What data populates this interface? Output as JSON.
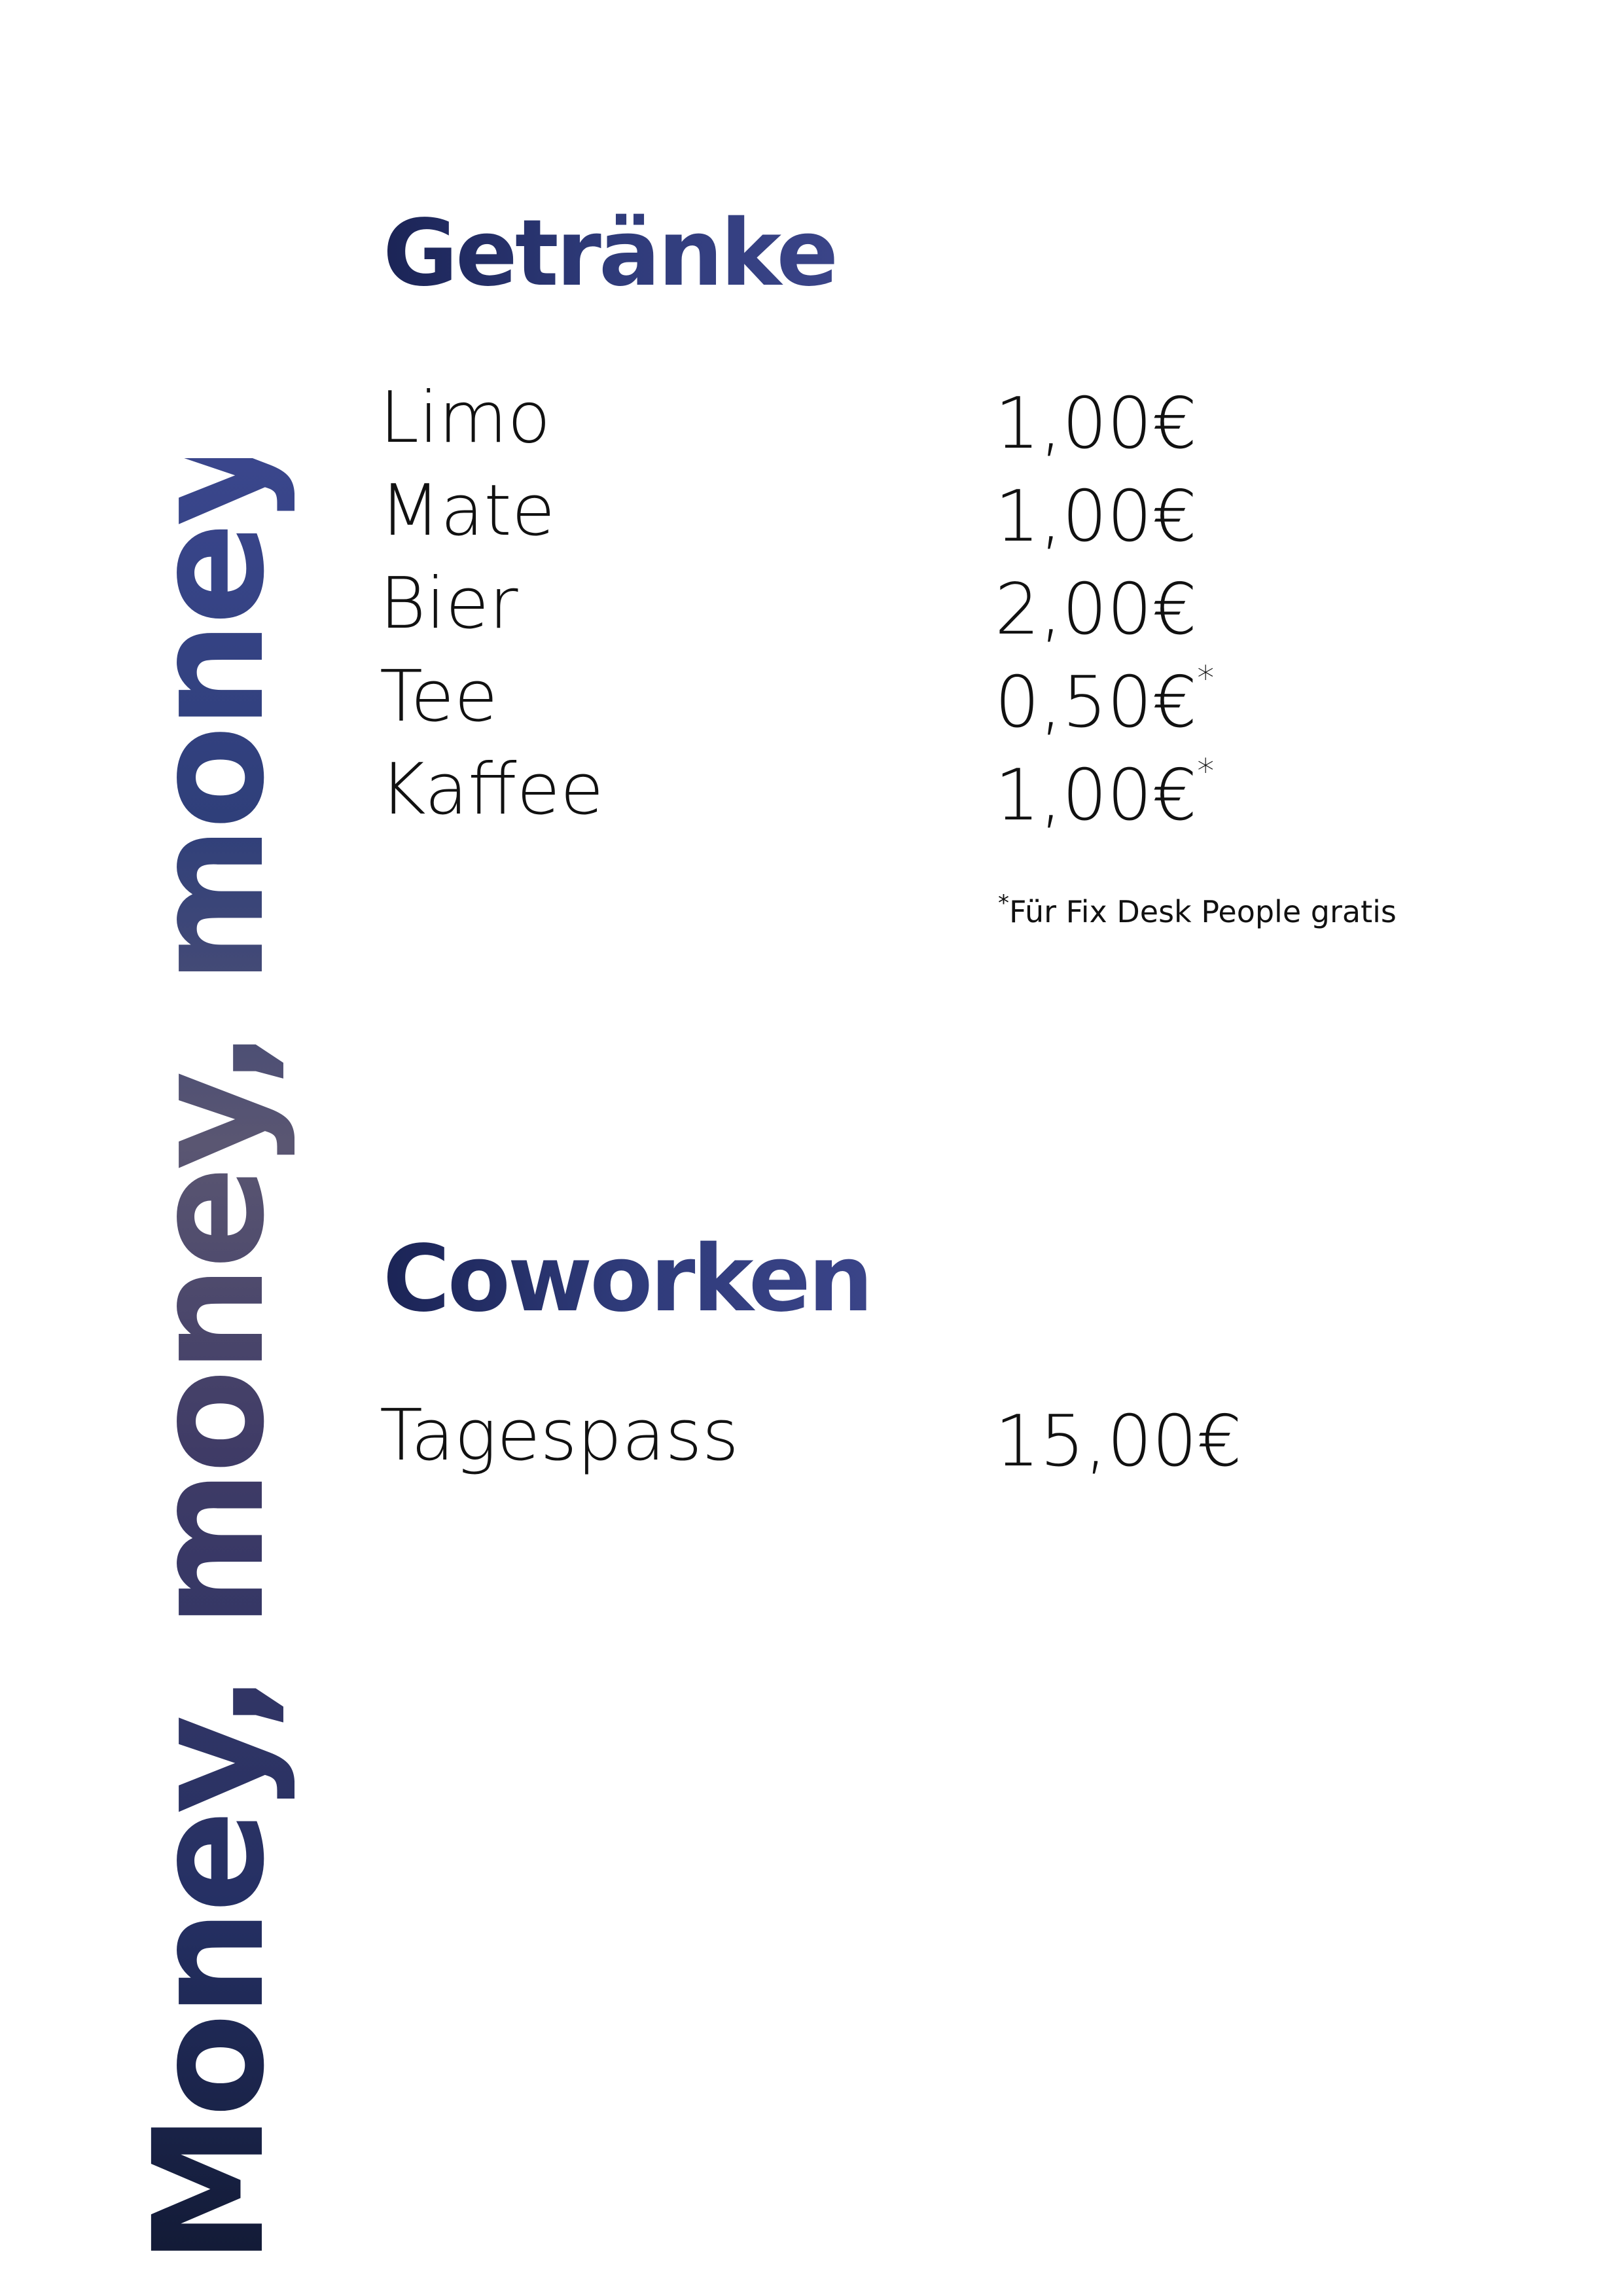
{
  "side_title": "Money, money, money",
  "sections": [
    {
      "heading": "Getränke",
      "items": [
        {
          "name": "Limo",
          "price": "1,00€",
          "mark": ""
        },
        {
          "name": "Mate",
          "price": "1,00€",
          "mark": ""
        },
        {
          "name": "Bier",
          "price": "2,00€",
          "mark": ""
        },
        {
          "name": "Tee",
          "price": "0,50€",
          "mark": "*"
        },
        {
          "name": "Kaffee",
          "price": "1,00€",
          "mark": "*"
        }
      ],
      "footnote": {
        "mark": "*",
        "text": "Für Fix Desk People gratis"
      }
    },
    {
      "heading": "Coworken",
      "items": [
        {
          "name": "Tagespass",
          "price": "15,00€",
          "mark": ""
        }
      ]
    }
  ],
  "colors": {
    "heading": "#2b3266",
    "text": "#111111",
    "background": "#ffffff"
  }
}
